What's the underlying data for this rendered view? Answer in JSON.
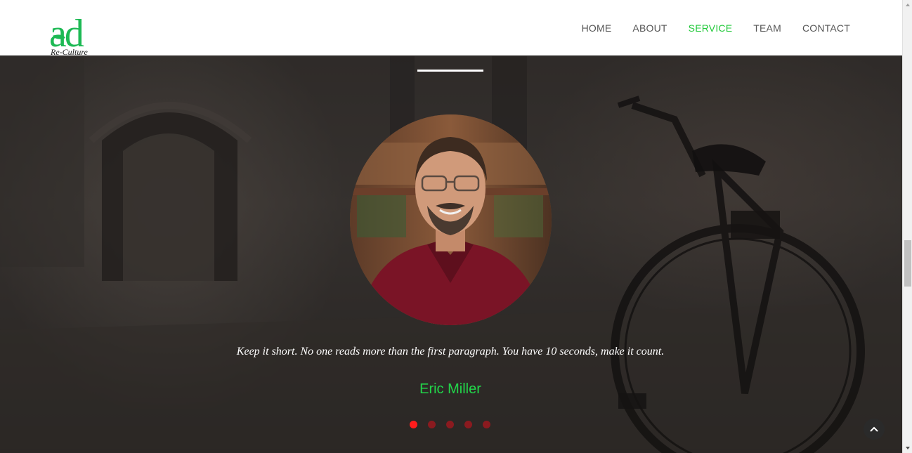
{
  "header": {
    "logo": {
      "letters": "ad",
      "subtitle": "Re-Culture",
      "brand_color": "#1db954"
    },
    "nav": [
      {
        "label": "HOME",
        "active": false
      },
      {
        "label": "ABOUT",
        "active": false
      },
      {
        "label": "SERVICE",
        "active": true
      },
      {
        "label": "TEAM",
        "active": false
      },
      {
        "label": "CONTACT",
        "active": false
      }
    ],
    "nav_active_color": "#21c93a"
  },
  "testimonial": {
    "quote": "Keep it short. No one reads more than the first paragraph. You have 10 seconds, make it count.",
    "author": "Eric Miller",
    "author_color": "#22d64a",
    "slides": 5,
    "active_slide": 0,
    "dot_active_color": "#ff1c1c",
    "dot_color": "#8b1a1f"
  },
  "icons": {
    "scroll_top": "chevron-up-icon"
  }
}
